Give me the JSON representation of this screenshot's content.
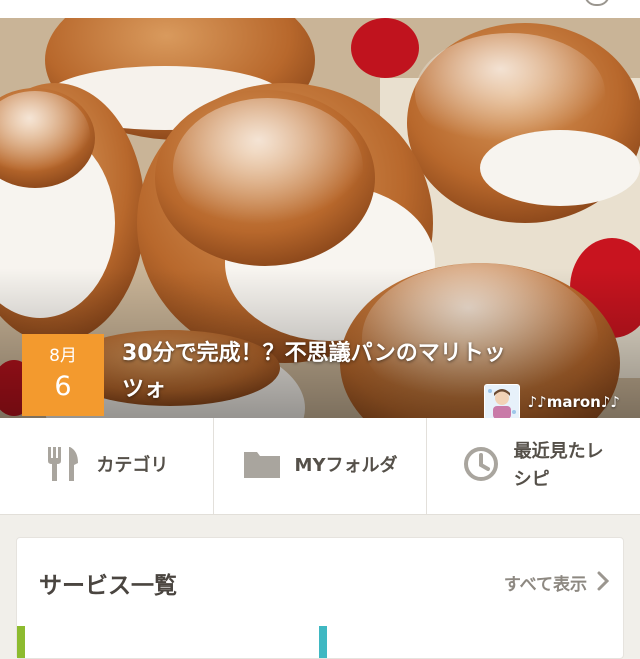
{
  "recipe": {
    "date_month": "8月",
    "date_day": "6",
    "title": "30分で完成！？不思議パンのマリトッツォ",
    "author_name": "♪♪maron♪♪"
  },
  "nav": {
    "items": [
      {
        "label": "カテゴリ",
        "icon": "fork-knife-icon"
      },
      {
        "label": "MYフォルダ",
        "icon": "folder-icon"
      },
      {
        "label": "最近見たレシピ",
        "icon": "clock-icon"
      }
    ]
  },
  "services": {
    "title": "サービス一覧",
    "view_all_label": "すべて表示"
  },
  "colors": {
    "accent_orange": "#f39a2e",
    "tile_green": "#8dbb2f",
    "tile_teal": "#3fb8c2",
    "text_dark": "#555049",
    "background": "#f1efea"
  }
}
